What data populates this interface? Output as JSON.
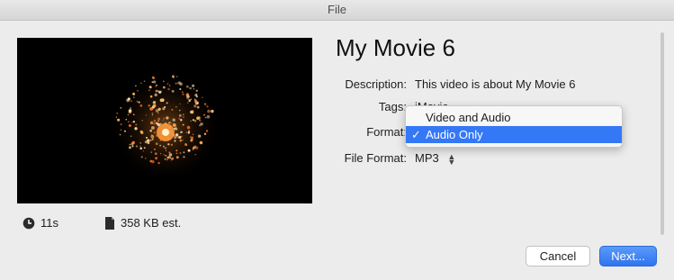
{
  "window": {
    "title": "File"
  },
  "movie": {
    "title": "My Movie 6"
  },
  "fields": {
    "description_label": "Description:",
    "description_value": "This video is about My Movie 6",
    "tags_label": "Tags:",
    "tags_value": "iMovie",
    "format_label": "Format:",
    "file_format_label": "File Format:",
    "file_format_value": "MP3"
  },
  "format_menu": {
    "options": [
      "Video and Audio",
      "Audio Only"
    ],
    "selected_index": 1,
    "check_mark": "✓"
  },
  "info": {
    "duration": "11s",
    "size": "358 KB est."
  },
  "buttons": {
    "cancel": "Cancel",
    "next": "Next..."
  },
  "colors": {
    "accent": "#3478f6",
    "background": "#ececec"
  },
  "icons": {
    "duration": "clock-icon",
    "size": "document-icon"
  }
}
